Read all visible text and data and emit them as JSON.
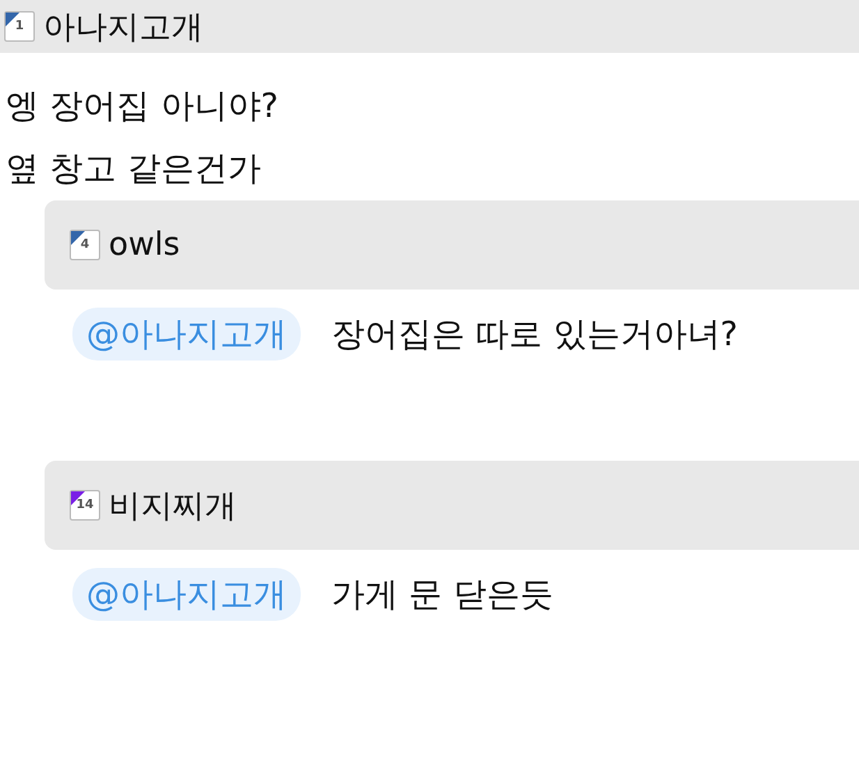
{
  "post": {
    "author": {
      "name": "아나지고개",
      "level": "1",
      "color": "#3366aa"
    },
    "lines": [
      "엥 장어집 아니야?",
      "옆 창고 같은건가"
    ]
  },
  "replies": [
    {
      "author": {
        "name": "owls",
        "level": "4",
        "color": "#3366aa"
      },
      "mention": "@아나지고개",
      "text": "장어집은 따로 있는거아녀?"
    },
    {
      "author": {
        "name": "비지찌개",
        "level": "14",
        "color": "#7a1fe6"
      },
      "mention": "@아나지고개",
      "text": "가게 문 닫은듯"
    }
  ]
}
